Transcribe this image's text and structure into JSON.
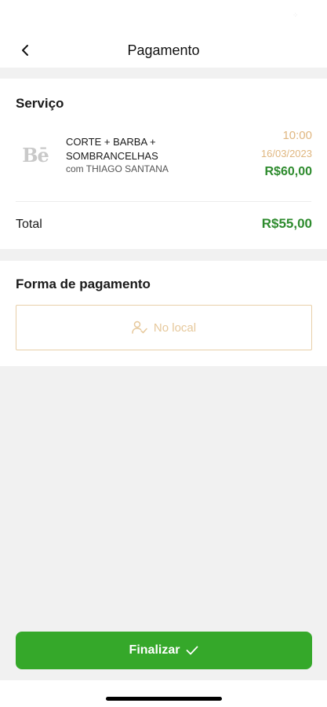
{
  "header": {
    "title": "Pagamento",
    "back_icon": "chevron-left-icon"
  },
  "service_section": {
    "title": "Serviço",
    "logo_text": "Bē",
    "service": {
      "name": "CORTE + BARBA + SOMBRANCELHAS",
      "professional": "com THIAGO SANTANA",
      "time": "10:00",
      "date": "16/03/2023",
      "price": "R$60,00"
    },
    "total_label": "Total",
    "total_value": "R$55,00"
  },
  "payment_section": {
    "title": "Forma de pagamento",
    "option": {
      "label": "No local",
      "icon": "user-check-icon"
    }
  },
  "footer": {
    "finish_label": "Finalizar",
    "finish_icon": "check-icon"
  },
  "colors": {
    "accent_green": "#35a82a",
    "price_green": "#2e8b2e",
    "gold": "#e0b781",
    "background": "#f1f1f1"
  }
}
